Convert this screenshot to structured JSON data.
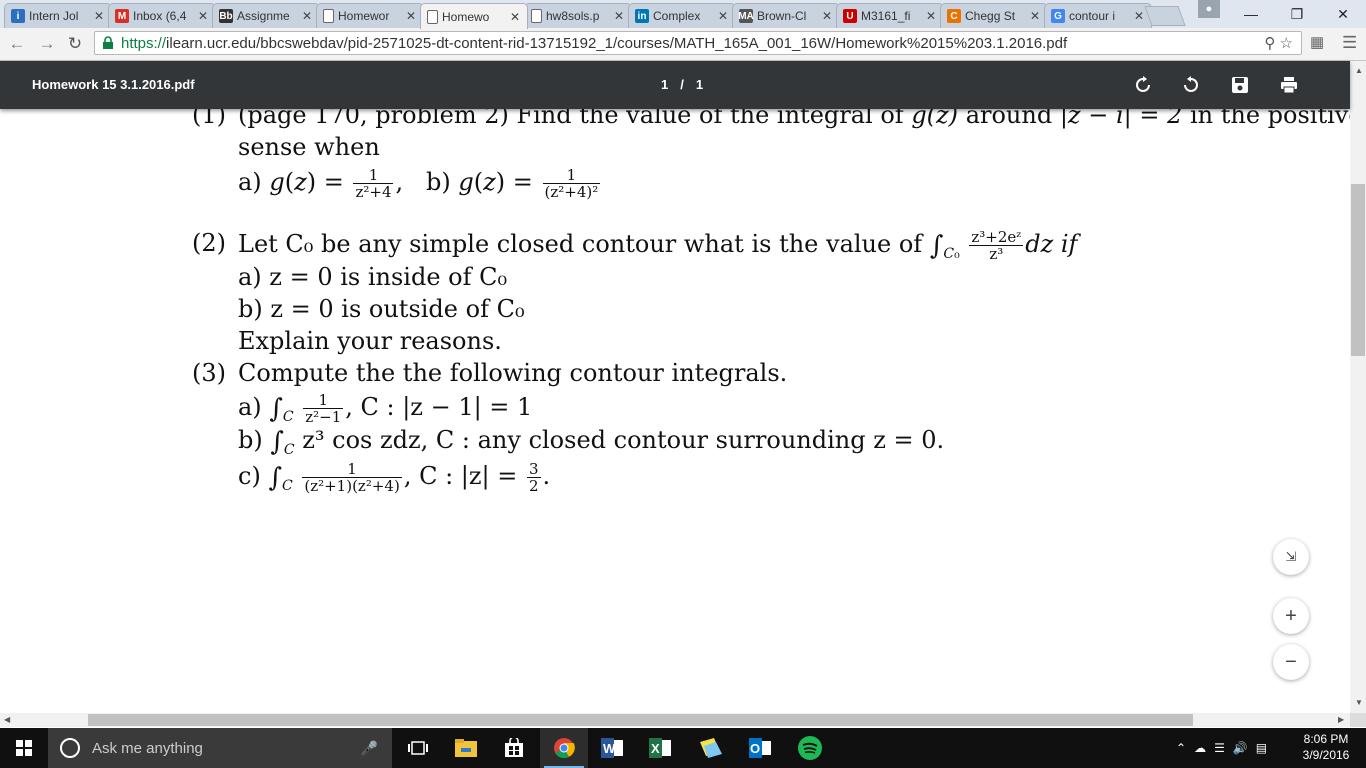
{
  "browser": {
    "tabs": [
      {
        "title": "Intern Jol",
        "icon": "info-icon",
        "color": "#2c6fbf",
        "glyph": "i",
        "active": false
      },
      {
        "title": "Inbox (6,4",
        "icon": "gmail-icon",
        "color": "#d93025",
        "glyph": "M",
        "active": false
      },
      {
        "title": "Assignme",
        "icon": "blackboard-icon",
        "color": "#333333",
        "glyph": "Bb",
        "active": false
      },
      {
        "title": "Homewor",
        "icon": "document-icon",
        "color": "#ffffff",
        "glyph": "",
        "active": false
      },
      {
        "title": "Homewo",
        "icon": "document-icon",
        "color": "#ffffff",
        "glyph": "",
        "active": true
      },
      {
        "title": "hw8sols.p",
        "icon": "document-icon",
        "color": "#ffffff",
        "glyph": "",
        "active": false
      },
      {
        "title": "Complex",
        "icon": "linkedin-icon",
        "color": "#0077b5",
        "glyph": "in",
        "active": false
      },
      {
        "title": "Brown-Cl",
        "icon": "math-icon",
        "color": "#555555",
        "glyph": "MA",
        "active": false
      },
      {
        "title": "M3161_fi",
        "icon": "utah-icon",
        "color": "#cc0000",
        "glyph": "U",
        "active": false
      },
      {
        "title": "Chegg St",
        "icon": "chegg-icon",
        "color": "#eb7100",
        "glyph": "C",
        "active": false
      },
      {
        "title": "contour i",
        "icon": "google-icon",
        "color": "#4285f4",
        "glyph": "G",
        "active": false
      }
    ],
    "url_scheme": "https://",
    "url_rest": "ilearn.ucr.edu/bbcswebdav/pid-2571025-dt-content-rid-13715192_1/courses/MATH_165A_001_16W/Homework%2015%203.1.2016.pdf"
  },
  "pdf": {
    "title": "Homework 15 3.1.2016.pdf",
    "page_current": "1",
    "page_sep": "/",
    "page_total": "1"
  },
  "doc": {
    "p1_num": "(1)",
    "p1_text": "(page 170, problem 2) Find the value of the integral of",
    "p1_g": "g(z)",
    "p1_around": "around",
    "p1_contour": "|z − i| = 2",
    "p1_tail": "in the positive",
    "p1_line2": "sense when",
    "p1_a": "a) ",
    "p1_b": "b) ",
    "p2_num": "(2)",
    "p2_text": "Let C₀ be any simple closed contour what is the value of",
    "p2_if": "dz if",
    "p2_a": "a) z = 0 is inside of C₀",
    "p2_b": "b) z = 0 is outside of C₀",
    "p2_explain": "Explain your reasons.",
    "p3_num": "(3)",
    "p3_text": "Compute the the following contour integrals.",
    "p3_a_tail": ", C : |z − 1| = 1",
    "p3_b_body": "z³ cos zdz, C : any closed contour surrounding z = 0.",
    "p3_c_tail": ", C : |z| =",
    "frac_one": "1",
    "frac_z2p4": "z²+4",
    "frac_z2p4sq": "(z²+4)²",
    "frac_p2_num": "z³+2eᶻ",
    "frac_p2_den": "z³",
    "frac_z2m1": "z²−1",
    "frac_c_den": "(z²+1)(z²+4)",
    "frac_three": "3",
    "frac_two": "2"
  },
  "taskbar": {
    "search_placeholder": "Ask me anything",
    "time": "8:06 PM",
    "date": "3/9/2016"
  }
}
